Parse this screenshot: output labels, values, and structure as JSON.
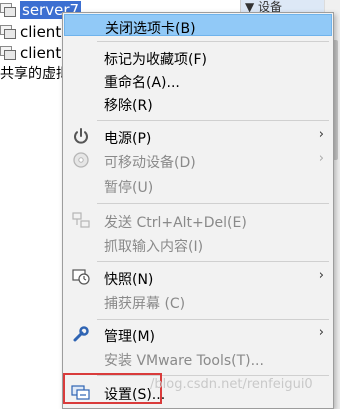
{
  "tree": {
    "items": [
      {
        "label": "server7"
      },
      {
        "label": "client"
      },
      {
        "label": "client"
      }
    ],
    "shared_label": "共享的虚拟"
  },
  "right_panel": {
    "header": "▼ 设备"
  },
  "menu": {
    "items": [
      {
        "label": "关闭选项卡(B)"
      },
      {
        "label": "标记为收藏项(F)"
      },
      {
        "label": "重命名(A)..."
      },
      {
        "label": "移除(R)"
      },
      {
        "label": "电源(P)"
      },
      {
        "label": "可移动设备(D)"
      },
      {
        "label": "暂停(U)"
      },
      {
        "label": "发送 Ctrl+Alt+Del(E)"
      },
      {
        "label": "抓取输入内容(I)"
      },
      {
        "label": "快照(N)"
      },
      {
        "label": "捕获屏幕 (C)"
      },
      {
        "label": "管理(M)"
      },
      {
        "label": "安装 VMware Tools(T)..."
      },
      {
        "label": "设置(S)..."
      }
    ],
    "submenu_arrow": "›"
  },
  "watermark": "/blog.csdn.net/renfeigui0",
  "colors": {
    "highlight": "#91c9f7",
    "selection": "#3c6fd1",
    "callout": "#d93b3b"
  }
}
